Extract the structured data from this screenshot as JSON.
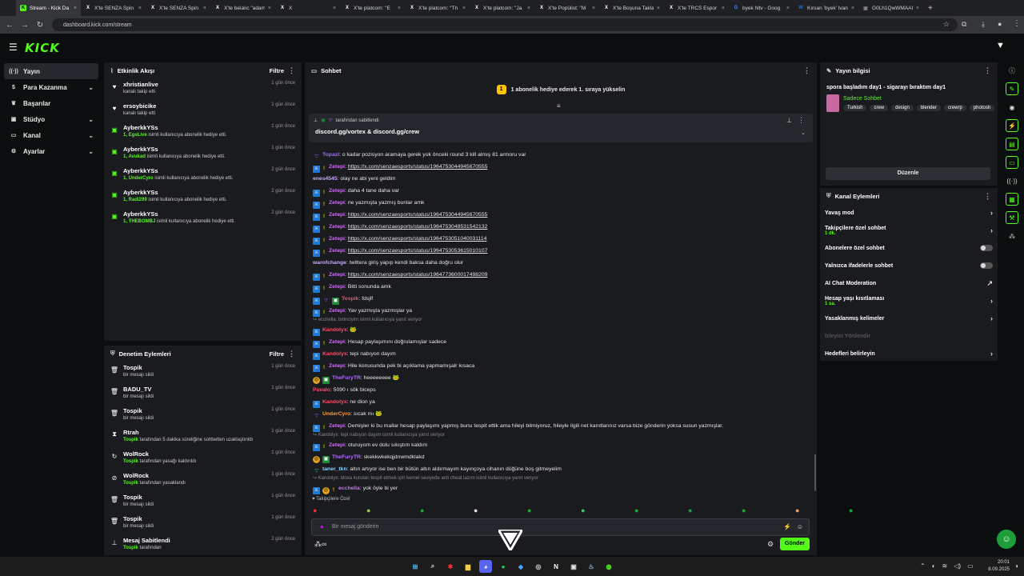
{
  "browser": {
    "tabs": [
      {
        "title": "Stream - Kick Da",
        "icon": "kick-icon",
        "color": "#53fc18"
      },
      {
        "title": "X'te SENZA Spin",
        "icon": "x-icon",
        "color": "#ffffff"
      },
      {
        "title": "X'te SENZA Spin",
        "icon": "x-icon",
        "color": "#ffffff"
      },
      {
        "title": "X'te belalıc \"adam",
        "icon": "x-icon",
        "color": "#ffffff"
      },
      {
        "title": "X",
        "icon": "x-icon",
        "color": "#ffffff"
      },
      {
        "title": "X'te platcom: \"E",
        "icon": "x-icon",
        "color": "#ffffff"
      },
      {
        "title": "X'te platcom: \"Th",
        "icon": "x-icon",
        "color": "#ffffff"
      },
      {
        "title": "X'te platcom: \"Ja",
        "icon": "x-icon",
        "color": "#ffffff"
      },
      {
        "title": "X'te Popülist: \"M",
        "icon": "x-icon",
        "color": "#ffffff"
      },
      {
        "title": "X'te Boşuna Takla",
        "icon": "x-icon",
        "color": "#ffffff"
      },
      {
        "title": "X'te TRCS Espor",
        "icon": "x-icon",
        "color": "#ffffff"
      },
      {
        "title": "byek hltv - Goog",
        "icon": "google-icon",
        "color": "#4285f4"
      },
      {
        "title": "Kırsan 'byek' İvan",
        "icon": "wiki-icon",
        "color": "#1e6fd9"
      },
      {
        "title": "G0Lh1QwWMAAI",
        "icon": "image-icon",
        "color": "#888888"
      }
    ],
    "new_tab": "+",
    "url": "dashboard.kick.com/stream"
  },
  "sidebar": {
    "items": [
      {
        "label": "Yayın",
        "icon": "broadcast-icon",
        "chevron": false
      },
      {
        "label": "Para Kazanma",
        "icon": "money-icon",
        "chevron": true
      },
      {
        "label": "Başarılar",
        "icon": "trophy-icon",
        "chevron": false
      },
      {
        "label": "Stüdyo",
        "icon": "studio-icon",
        "chevron": true
      },
      {
        "label": "Kanal",
        "icon": "channel-icon",
        "chevron": true
      },
      {
        "label": "Ayarlar",
        "icon": "settings-icon",
        "chevron": true
      }
    ]
  },
  "activity": {
    "title": "Etkinlik Akışı",
    "filter": "Filtre",
    "items": [
      {
        "icon": "heart-icon",
        "name": "xhristianlive",
        "sub_b": "",
        "sub": "kanalı takip etti",
        "time": "1 gün önce"
      },
      {
        "icon": "heart-icon",
        "name": "ersoybicike",
        "sub_b": "",
        "sub": "kanalı takip etti",
        "time": "1 gün önce"
      },
      {
        "icon": "gift-icon",
        "name": "AyberkkYSs",
        "sub_b": "1, EgeLive",
        "sub": " isimli kullanıcıya abonelik hediye etti.",
        "time": "1 gün önce"
      },
      {
        "icon": "gift-icon",
        "name": "AyberkkYSs",
        "sub_b": "1, Avukad",
        "sub": " isimli kullanıcıya abonelik hediye etti.",
        "time": "1 gün önce"
      },
      {
        "icon": "gift-icon",
        "name": "AyberkkYSs",
        "sub_b": "1, UnderCyro",
        "sub": " isimli kullanıcıya abonelik hediye etti.",
        "time": "2 gün önce"
      },
      {
        "icon": "gift-icon",
        "name": "AyberkkYSs",
        "sub_b": "1, Radi299",
        "sub": " isimli kullanıcıya abonelik hediye etti.",
        "time": "2 gün önce"
      },
      {
        "icon": "gift-icon",
        "name": "AyberkkYSs",
        "sub_b": "1, THEBOMBJ",
        "sub": " isimli kullanıcıya abonelik hediye etti.",
        "time": "2 gün önce"
      }
    ]
  },
  "moderation": {
    "title": "Denetim Eylemleri",
    "filter": "Filtre",
    "items": [
      {
        "icon": "trash-icon",
        "name": "Tospik",
        "sub_b": "",
        "sub": "bir mesajı sildi",
        "time": "1 gün önce"
      },
      {
        "icon": "trash-icon",
        "name": "BADU_TV",
        "sub_b": "",
        "sub": "bir mesajı sildi",
        "time": "1 gün önce"
      },
      {
        "icon": "trash-icon",
        "name": "Tospik",
        "sub_b": "",
        "sub": "bir mesajı sildi",
        "time": "1 gün önce"
      },
      {
        "icon": "hourglass-icon",
        "name": "Rtrah",
        "sub_b": "Tospik",
        "sub": " tarafından 5 dakika süreliğine sohbetten uzaklaştırıldı",
        "time": "1 gün önce"
      },
      {
        "icon": "unban-icon",
        "name": "WolRock",
        "sub_b": "Tospik",
        "sub": " tarafından yasağı kaldırıldı",
        "time": "1 gün önce"
      },
      {
        "icon": "ban-icon",
        "name": "WolRock",
        "sub_b": "Tospik",
        "sub": " tarafından yasaklandı",
        "time": "1 gün önce"
      },
      {
        "icon": "trash-icon",
        "name": "Tospik",
        "sub_b": "",
        "sub": "bir mesajı sildi",
        "time": "1 gün önce"
      },
      {
        "icon": "trash-icon",
        "name": "Tospik",
        "sub_b": "",
        "sub": "bir mesajı sildi",
        "time": "1 gün önce"
      },
      {
        "icon": "pin-icon",
        "name": "Mesaj Sabitlendi",
        "sub_b": "Tospik",
        "sub": " tarafından",
        "time": "2 gün önce"
      }
    ]
  },
  "chat": {
    "title": "Sohbet",
    "goal": "1 abonelik hediye ederek 1. sıraya yükselin",
    "pinned_by": "tarafından sabitlendi",
    "pinned_text": "discord.gg/vortex & discord.gg/crew",
    "messages": [
      {
        "b": [
          "purple"
        ],
        "user": "Topazl",
        "color": "#a068ff",
        "text": "o kadar pozisyon aramaya gerek yok önceki round 3 kill almış 81 armoru var",
        "link": false
      },
      {
        "b": [
          "blue",
          "yellow"
        ],
        "user": "Zetepi",
        "color": "#d36bff",
        "text": "https://x.com/senzaesports/status/1964753044945670555",
        "link": true
      },
      {
        "b": [],
        "user": "enes4545",
        "color": "#c9a6ff",
        "text": "olay ne abi yeni geldim",
        "link": false
      },
      {
        "b": [
          "blue",
          "yellow"
        ],
        "user": "Zetepi",
        "color": "#d36bff",
        "text": "daha 4 tane daha var",
        "link": false
      },
      {
        "b": [
          "blue",
          "yellow"
        ],
        "user": "Zetepi",
        "color": "#d36bff",
        "text": "ne yazmışta yazmış bunlar amk",
        "link": false
      },
      {
        "b": [
          "blue",
          "yellow"
        ],
        "user": "Zetepi",
        "color": "#d36bff",
        "text": "https://x.com/senzaesports/status/1964753044945670555",
        "link": true
      },
      {
        "b": [
          "blue",
          "yellow"
        ],
        "user": "Zetepi",
        "color": "#d36bff",
        "text": "https://x.com/senzaesports/status/1964753048531542132",
        "link": true
      },
      {
        "b": [
          "blue",
          "yellow"
        ],
        "user": "Zetepi",
        "color": "#d36bff",
        "text": "https://x.com/senzaesports/status/1964753051040031114",
        "link": true
      },
      {
        "b": [
          "blue",
          "yellow"
        ],
        "user": "Zetepi",
        "color": "#d36bff",
        "text": "https://x.com/senzaesports/status/1964753053615010107",
        "link": true
      },
      {
        "b": [],
        "user": "warofchange",
        "color": "#c9a6ff",
        "text": "twittera giriş yapıp kendi baksa daha doğru olur",
        "link": false
      },
      {
        "b": [
          "blue",
          "yellow"
        ],
        "user": "Zetepi",
        "color": "#d36bff",
        "text": "https://x.com/senzaesports/status/1964773600017498209",
        "link": true
      },
      {
        "b": [
          "blue",
          "yellow"
        ],
        "user": "Zetepi",
        "color": "#d36bff",
        "text": "Bitti sonunda amk",
        "link": false
      },
      {
        "b": [
          "blue",
          "purple",
          "green"
        ],
        "user": "Tospik",
        "color": "#ff4d6a",
        "text": "fdsjlf",
        "link": false
      },
      {
        "b": [
          "blue",
          "yellow"
        ],
        "user": "Zetepi",
        "color": "#d36bff",
        "text": "Yav yazmışta yazmışlar ya",
        "link": false
      },
      {
        "reply": "ecchella: birinciyim isimli kullanıcıya yanıt veriyor"
      },
      {
        "b": [
          "blue"
        ],
        "user": "Kandolyx",
        "color": "#ff4d6a",
        "text": "🐸",
        "link": false
      },
      {
        "b": [
          "blue",
          "yellow"
        ],
        "user": "Zetepi",
        "color": "#d36bff",
        "text": "Hesap paylaşımını doğrulamışlar sadece",
        "link": false
      },
      {
        "b": [
          "blue"
        ],
        "user": "Kandolyx",
        "color": "#ff4d6a",
        "text": "tepi nabıyon dayım",
        "link": false
      },
      {
        "b": [
          "blue",
          "yellow"
        ],
        "user": "Zetepi",
        "color": "#d36bff",
        "text": "Hile konusunda pek bi açıklama yapmamışalr kısaca",
        "link": false
      },
      {
        "b": [
          "gold",
          "green"
        ],
        "user": "TheFuryTR",
        "color": "#b06bff",
        "text": "heeeeeeee 🐸",
        "link": false
      },
      {
        "b": [],
        "user": "Pavalo",
        "color": "#ff4d6a",
        "text": "5090 ı sök biceps",
        "link": false
      },
      {
        "b": [
          "blue"
        ],
        "user": "Kandolyx",
        "color": "#ff4d6a",
        "text": "ne dion ya",
        "link": false
      },
      {
        "b": [
          "purple"
        ],
        "user": "UnderCyro",
        "color": "#ff9d3a",
        "text": "sıcak mı 🐸",
        "link": false
      },
      {
        "b": [
          "blue",
          "yellow"
        ],
        "user": "Zetepi",
        "color": "#d36bff",
        "text": "Demişler ki bu mallar hesap paylaşımı yapmış bunu tespit ettik ama hileyi bilmiyoruz, hileyle ilgili net kanıtlarınız varsa bize gönderin yoksa susun yazmışlar.",
        "link": false
      },
      {
        "reply": "Kandolyx: tepi nabıyon dayım isimli kullanıcıya yanıt veriyor"
      },
      {
        "b": [
          "blue",
          "yellow"
        ],
        "user": "Zetepi",
        "color": "#d36bff",
        "text": "oturuyom ev dolu sıkıştım kaldım",
        "link": false
      },
      {
        "b": [
          "gold",
          "green"
        ],
        "user": "TheFuryTR",
        "color": "#b06bff",
        "text": "skekkwkekqjdnwmdklakd",
        "link": false
      },
      {
        "b": [
          "teal"
        ],
        "user": "taner_tkn",
        "color": "#8fd3ff",
        "text": "altın artıyor ise ben bir bütün altın aldırmayım kayınçoya cihanın düğüne boş gitmeyelim",
        "link": false
      },
      {
        "reply": "Kandolyx: bloxa kuruları tespit etmek için kernel seviyede anti cheat lazım isimli kullanıcıya yanıt veriyor"
      },
      {
        "b": [
          "blue",
          "gold",
          "yellow"
        ],
        "user": "ecchella",
        "color": "#d36bff",
        "text": "yok öyle bi yer",
        "link": false
      }
    ],
    "followers_only": "Takipçilere Özel",
    "input_placeholder": "Bir mesaj gönderin",
    "send": "Gönder"
  },
  "stream_info": {
    "title": "Yayın bilgisi",
    "stream_title": "spora başladım day1 - sigarayı bıraktım day1",
    "category": "Sadece Sohbet",
    "tags": [
      "Turkish",
      "crew",
      "design",
      "blender",
      "crewrp",
      "photosh"
    ],
    "edit": "Düzenle"
  },
  "channel_actions": {
    "title": "Kanal Eylemleri",
    "items": [
      {
        "label": "Yavaş mod",
        "sub": "",
        "type": "arrow",
        "disabled": false
      },
      {
        "label": "Takipçilere özel sohbet",
        "sub": "1 dk.",
        "type": "arrow",
        "disabled": false
      },
      {
        "label": "Abonelere özel sohbet",
        "sub": "",
        "type": "toggle",
        "disabled": false
      },
      {
        "label": "Yalnızca ifadelerle sohbet",
        "sub": "",
        "type": "toggle",
        "disabled": false
      },
      {
        "label": "AI Chat Moderation",
        "sub": "",
        "type": "external",
        "disabled": false
      },
      {
        "label": "Hesap yaşı kısıtlaması",
        "sub": "1 sa.",
        "type": "arrow",
        "disabled": false
      },
      {
        "label": "Yasaklanmış kelimeler",
        "sub": "",
        "type": "arrow",
        "disabled": false
      },
      {
        "label": "İzleyici Yönlendir",
        "sub": "",
        "type": "none",
        "disabled": true
      },
      {
        "label": "Hedefleri belirleyin",
        "sub": "",
        "type": "arrow",
        "disabled": false
      }
    ]
  },
  "taskbar": {
    "time": "20:01",
    "date": "8.09.2025"
  },
  "colors": {
    "accent": "#53fc18",
    "panel": "#191b1f",
    "bg": "#0b0e0f"
  }
}
